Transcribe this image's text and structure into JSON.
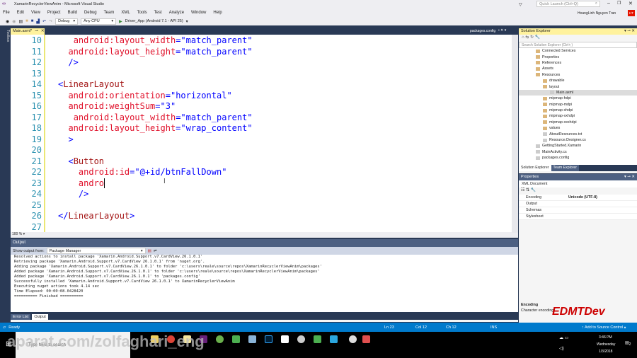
{
  "window": {
    "title": "XamarinRecyclerViewAnim - Microsoft Visual Studio",
    "quick_launch_placeholder": "Quick Launch (Ctrl+Q)",
    "user": "HoangLinh Nguyen Tran",
    "user_initials": "HT"
  },
  "menu": [
    "File",
    "Edit",
    "View",
    "Project",
    "Build",
    "Debug",
    "Team",
    "XML",
    "Tools",
    "Test",
    "Analyze",
    "Window",
    "Help"
  ],
  "toolbar": {
    "config": "Debug",
    "platform": "Any CPU",
    "run_target": "Driver_App (Android 7.1 - API 25)"
  },
  "tabs": {
    "active": "Main.axml*",
    "preview": "packages.config",
    "toolbox": "Toolbox"
  },
  "editor": {
    "zoom": "100 %",
    "lines": [
      {
        "n": "10",
        "indent": "   ",
        "seg": [
          [
            "a",
            "android:layout_width"
          ],
          [
            "p",
            "=\""
          ],
          [
            "v",
            "match_parent"
          ],
          [
            "p",
            "\""
          ]
        ]
      },
      {
        "n": "11",
        "indent": "  ",
        "seg": [
          [
            "a",
            "android:layout_height"
          ],
          [
            "p",
            "=\""
          ],
          [
            "v",
            "match_parent"
          ],
          [
            "p",
            "\""
          ]
        ]
      },
      {
        "n": "12",
        "indent": "  ",
        "seg": [
          [
            "p",
            "/>"
          ]
        ]
      },
      {
        "n": "13",
        "indent": "",
        "seg": []
      },
      {
        "n": "14",
        "indent": "",
        "seg": [
          [
            "p",
            "<"
          ],
          [
            "t",
            "LinearLayout"
          ]
        ]
      },
      {
        "n": "15",
        "indent": "  ",
        "seg": [
          [
            "a",
            "android:orientation"
          ],
          [
            "p",
            "=\""
          ],
          [
            "v",
            "horizontal"
          ],
          [
            "p",
            "\""
          ]
        ]
      },
      {
        "n": "16",
        "indent": "  ",
        "seg": [
          [
            "a",
            "android:weightSum"
          ],
          [
            "p",
            "=\""
          ],
          [
            "v",
            "3"
          ],
          [
            "p",
            "\""
          ]
        ]
      },
      {
        "n": "17",
        "indent": "   ",
        "seg": [
          [
            "a",
            "android:layout_width"
          ],
          [
            "p",
            "=\""
          ],
          [
            "v",
            "match_parent"
          ],
          [
            "p",
            "\""
          ]
        ]
      },
      {
        "n": "18",
        "indent": "  ",
        "seg": [
          [
            "a",
            "android:layout_height"
          ],
          [
            "p",
            "=\""
          ],
          [
            "v",
            "wrap_content"
          ],
          [
            "p",
            "\""
          ]
        ]
      },
      {
        "n": "19",
        "indent": "  ",
        "seg": [
          [
            "p",
            ">"
          ]
        ]
      },
      {
        "n": "20",
        "indent": "",
        "seg": []
      },
      {
        "n": "21",
        "indent": "  ",
        "seg": [
          [
            "p",
            "<"
          ],
          [
            "t",
            "Button"
          ]
        ]
      },
      {
        "n": "22",
        "indent": "    ",
        "seg": [
          [
            "a",
            "android:id"
          ],
          [
            "p",
            "=\""
          ],
          [
            "v",
            "@+id/btnFallDown"
          ],
          [
            "p",
            "\""
          ]
        ]
      },
      {
        "n": "23",
        "indent": "    ",
        "seg": [
          [
            "a",
            "andro"
          ]
        ]
      },
      {
        "n": "24",
        "indent": "    ",
        "seg": [
          [
            "p",
            "/>"
          ]
        ]
      },
      {
        "n": "25",
        "indent": "",
        "seg": []
      },
      {
        "n": "26",
        "indent": "",
        "seg": [
          [
            "p",
            "</"
          ],
          [
            "t",
            "LinearLayout"
          ],
          [
            "p",
            ">"
          ]
        ]
      },
      {
        "n": "27",
        "indent": "",
        "seg": []
      }
    ]
  },
  "output": {
    "title": "Output",
    "show_from_label": "Show output from:",
    "source": "Package Manager",
    "lines": [
      "Resolved actions to install package 'Xamarin.Android.Support.v7.CardView.26.1.0.1'",
      "Retrieving package 'Xamarin.Android.Support.v7.CardView 26.1.0.1' from 'nuget.org'.",
      "Adding package 'Xamarin.Android.Support.v7.CardView.26.1.0.1' to folder 'c:\\users\\reale\\source\\repos\\XamarinRecyclerViewAnim\\packages'",
      "Added package 'Xamarin.Android.Support.v7.CardView.26.1.0.1' to folder 'c:\\users\\reale\\source\\repos\\XamarinRecyclerViewAnim\\packages'",
      "Added package 'Xamarin.Android.Support.v7.CardView.26.1.0.1' to 'packages.config'",
      "Successfully installed 'Xamarin.Android.Support.v7.CardView 26.1.0.1' to XamarinRecyclerViewAnim",
      "Executing nuget actions took 4.14 sec",
      "Time Elapsed: 00:00:08.0428420",
      "========== Finished =========="
    ],
    "tabs": [
      "Error List",
      "Output"
    ]
  },
  "solution_explorer": {
    "title": "Solution Explorer",
    "search_placeholder": "Search Solution Explorer (Ctrl+;)",
    "items": [
      {
        "label": "Connected Services",
        "depth": 1
      },
      {
        "label": "Properties",
        "depth": 1
      },
      {
        "label": "References",
        "depth": 1
      },
      {
        "label": "Assets",
        "depth": 1
      },
      {
        "label": "Resources",
        "depth": 1
      },
      {
        "label": "drawable",
        "depth": 2
      },
      {
        "label": "layout",
        "depth": 2
      },
      {
        "label": "Main.axml",
        "depth": 3
      },
      {
        "label": "mipmap-hdpi",
        "depth": 2
      },
      {
        "label": "mipmap-mdpi",
        "depth": 2
      },
      {
        "label": "mipmap-xhdpi",
        "depth": 2
      },
      {
        "label": "mipmap-xxhdpi",
        "depth": 2
      },
      {
        "label": "mipmap-xxxhdpi",
        "depth": 2
      },
      {
        "label": "values",
        "depth": 2
      },
      {
        "label": "AboutResources.txt",
        "depth": 2
      },
      {
        "label": "Resource.Designer.cs",
        "depth": 2
      },
      {
        "label": "GettingStarted.Xamarin",
        "depth": 1
      },
      {
        "label": "MainActivity.cs",
        "depth": 1
      },
      {
        "label": "packages.config",
        "depth": 1
      }
    ],
    "tabs": [
      "Solution Explorer",
      "Team Explorer"
    ]
  },
  "properties": {
    "title": "Properties",
    "object": "XML Document",
    "rows": [
      {
        "name": "Encoding",
        "value": "Unicode (UTF-8)"
      },
      {
        "name": "Output",
        "value": ""
      },
      {
        "name": "Schemas",
        "value": ""
      },
      {
        "name": "Stylesheet",
        "value": ""
      }
    ],
    "desc_title": "Encoding",
    "desc_text": "Character encoding"
  },
  "status": {
    "ready": "Ready",
    "ln": "Ln 23",
    "col": "Col 12",
    "ch": "Ch 12",
    "mode": "INS",
    "source_control": "Add to Source Control"
  },
  "taskbar": {
    "search_placeholder": "Type here to search",
    "time": "3:46 PM",
    "day": "Wednesday",
    "date": "1/3/2018",
    "notifications": "2"
  },
  "overlay": {
    "watermark": "aparat.com/zolfaghari_eng",
    "logo": "EDMTDev"
  }
}
